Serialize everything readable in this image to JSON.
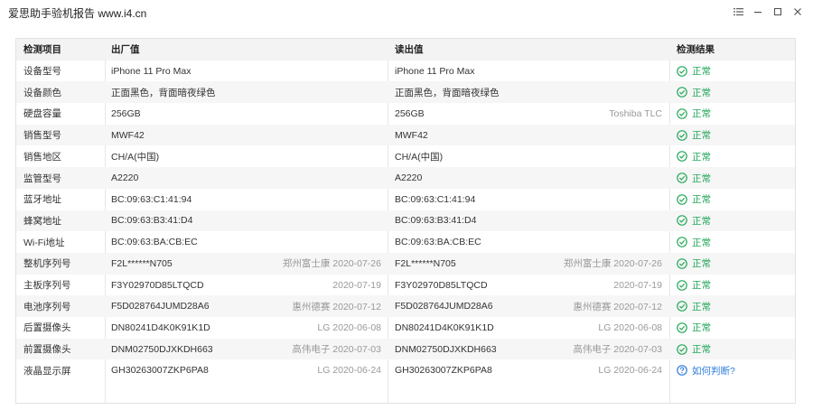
{
  "window": {
    "title": "爱思助手验机报告 www.i4.cn"
  },
  "table": {
    "headers": {
      "item": "检测项目",
      "factory": "出厂值",
      "read": "读出值",
      "result": "检测结果"
    },
    "rows": [
      {
        "item": "设备型号",
        "factory": "iPhone 11 Pro Max",
        "factory_note": "",
        "read": "iPhone 11 Pro Max",
        "read_note": "",
        "result": "正常",
        "result_type": "ok"
      },
      {
        "item": "设备颜色",
        "factory": "正面黑色，背面暗夜绿色",
        "factory_note": "",
        "read": "正面黑色，背面暗夜绿色",
        "read_note": "",
        "result": "正常",
        "result_type": "ok"
      },
      {
        "item": "硬盘容量",
        "factory": "256GB",
        "factory_note": "",
        "read": "256GB",
        "read_note": "Toshiba TLC",
        "result": "正常",
        "result_type": "ok"
      },
      {
        "item": "销售型号",
        "factory": "MWF42",
        "factory_note": "",
        "read": "MWF42",
        "read_note": "",
        "result": "正常",
        "result_type": "ok"
      },
      {
        "item": "销售地区",
        "factory": "CH/A(中国)",
        "factory_note": "",
        "read": "CH/A(中国)",
        "read_note": "",
        "result": "正常",
        "result_type": "ok"
      },
      {
        "item": "监管型号",
        "factory": "A2220",
        "factory_note": "",
        "read": "A2220",
        "read_note": "",
        "result": "正常",
        "result_type": "ok"
      },
      {
        "item": "蓝牙地址",
        "factory": "BC:09:63:C1:41:94",
        "factory_note": "",
        "read": "BC:09:63:C1:41:94",
        "read_note": "",
        "result": "正常",
        "result_type": "ok"
      },
      {
        "item": "蜂窝地址",
        "factory": "BC:09:63:B3:41:D4",
        "factory_note": "",
        "read": "BC:09:63:B3:41:D4",
        "read_note": "",
        "result": "正常",
        "result_type": "ok"
      },
      {
        "item": "Wi-Fi地址",
        "factory": "BC:09:63:BA:CB:EC",
        "factory_note": "",
        "read": "BC:09:63:BA:CB:EC",
        "read_note": "",
        "result": "正常",
        "result_type": "ok"
      },
      {
        "item": "整机序列号",
        "factory": "F2L******N705",
        "factory_note": "郑州富士康 2020-07-26",
        "read": "F2L******N705",
        "read_note": "郑州富士康 2020-07-26",
        "result": "正常",
        "result_type": "ok"
      },
      {
        "item": "主板序列号",
        "factory": "F3Y02970D85LTQCD",
        "factory_note": "2020-07-19",
        "read": "F3Y02970D85LTQCD",
        "read_note": "2020-07-19",
        "result": "正常",
        "result_type": "ok"
      },
      {
        "item": "电池序列号",
        "factory": "F5D028764JUMD28A6",
        "factory_note": "惠州德赛 2020-07-12",
        "read": "F5D028764JUMD28A6",
        "read_note": "惠州德赛 2020-07-12",
        "result": "正常",
        "result_type": "ok"
      },
      {
        "item": "后置摄像头",
        "factory": "DN80241D4K0K91K1D",
        "factory_note": "LG 2020-06-08",
        "read": "DN80241D4K0K91K1D",
        "read_note": "LG 2020-06-08",
        "result": "正常",
        "result_type": "ok"
      },
      {
        "item": "前置摄像头",
        "factory": "DNM02750DJXKDH663",
        "factory_note": "高伟电子 2020-07-03",
        "read": "DNM02750DJXKDH663",
        "read_note": "高伟电子 2020-07-03",
        "result": "正常",
        "result_type": "ok"
      },
      {
        "item": "液晶显示屏",
        "factory": "GH30263007ZKP6PA8",
        "factory_note": "LG 2020-06-24",
        "read": "GH30263007ZKP6PA8",
        "read_note": "LG 2020-06-24",
        "result": "如何判断?",
        "result_type": "link"
      }
    ]
  },
  "colors": {
    "ok": "#23a85a",
    "link": "#2f7bdc"
  },
  "icons": {
    "ok": "check-circle-icon",
    "link": "question-circle-icon"
  }
}
